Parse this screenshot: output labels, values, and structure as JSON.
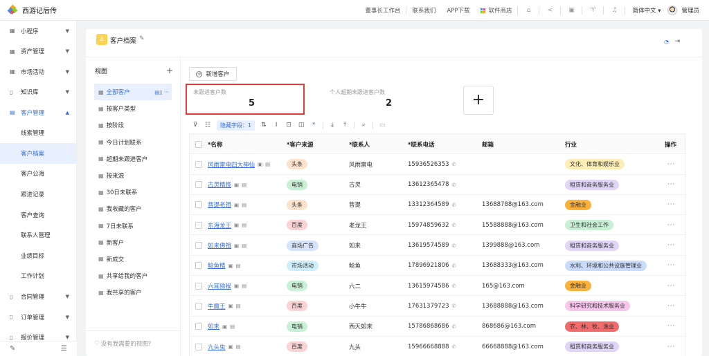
{
  "app": {
    "title": "西游记后传",
    "logo_colors": [
      "#f5a623",
      "#4a90e2",
      "#7ed321",
      "#e94e77"
    ]
  },
  "topbar": {
    "links": [
      "董事长工作台",
      "联系我们",
      "APP下载",
      "软件商店"
    ],
    "app_store_icon": "grid-colorful-icon",
    "icons": [
      "home-icon",
      "share-icon",
      "app-icon",
      "shirt-icon",
      "bell-icon"
    ],
    "language": "简体中文",
    "user": "管理员"
  },
  "sidebar": {
    "groups_top": [
      {
        "label": "小程序",
        "icon": "grid-icon"
      },
      {
        "label": "资产管理",
        "icon": "grid-icon"
      },
      {
        "label": "市场活动",
        "icon": "grid-icon"
      },
      {
        "label": "知识库",
        "icon": "doc-icon"
      }
    ],
    "open_group": {
      "label": "客户管理",
      "icon": "contact-icon"
    },
    "sub_items": [
      "线索管理",
      "客户档案",
      "客户公海",
      "跟进记录",
      "客户查询",
      "联系人管理",
      "业绩目标",
      "工作计划"
    ],
    "active_sub": "客户档案",
    "groups_bottom": [
      {
        "label": "合同管理",
        "icon": "doc-icon"
      },
      {
        "label": "订单管理",
        "icon": "doc-icon"
      },
      {
        "label": "报价管理",
        "icon": "doc-icon"
      }
    ]
  },
  "header": {
    "title": "客户档案"
  },
  "views": {
    "title": "视图",
    "items": [
      "全部客户",
      "按客户类型",
      "按阶段",
      "今日计划联系",
      "超期未跟进客户",
      "按来源",
      "30日未联系",
      "我收藏的客户",
      "7日未联系",
      "新客户",
      "新成交",
      "共享给我的客户",
      "我共享的客户"
    ],
    "active": "全部客户",
    "footer": "没有我需要的视图?"
  },
  "actions": {
    "add_customer": "新增客户"
  },
  "stats": [
    {
      "label": "未跟进客户数",
      "value": "5"
    },
    {
      "label": "个人超期未跟进客户数",
      "value": "2"
    }
  ],
  "toolbar": {
    "hidden_fields": "隐藏字段：1"
  },
  "table": {
    "columns": [
      "*名称",
      "*客户来源",
      "*联系人",
      "*联系电话",
      "邮箱",
      "行业",
      "操作"
    ],
    "rows": [
      {
        "name": "风雨雷电四大神仙",
        "source": "头条",
        "contact": "风雨雷电",
        "phone": "15936526353",
        "email": "",
        "industry": "文化、体育和娱乐业"
      },
      {
        "name": "古灵精怪",
        "source": "电销",
        "contact": "古灵",
        "phone": "13612365478",
        "email": "",
        "industry": "租赁和商务服务业"
      },
      {
        "name": "菩提老祖",
        "source": "头条",
        "contact": "菩提",
        "phone": "13312364589",
        "email": "13688788@163.com",
        "industry": "金融业"
      },
      {
        "name": "东海龙王",
        "source": "百度",
        "contact": "老龙王",
        "phone": "15974859632",
        "email": "15588888@163.com",
        "industry": "卫生和社会工作"
      },
      {
        "name": "如来佛祖",
        "source": "商场广告",
        "contact": "如来",
        "phone": "13619574589",
        "email": "1399888@163.com",
        "industry": "租赁和商务服务业"
      },
      {
        "name": "鲶鱼精",
        "source": "市场活动",
        "contact": "鲶鱼",
        "phone": "17896921806",
        "email": "13688333@163.com",
        "industry": "水利、环境和公共设施管理业"
      },
      {
        "name": "六耳猕猴",
        "source": "电销",
        "contact": "六二",
        "phone": "13615974586",
        "email": "165@163.com",
        "industry": "金融业"
      },
      {
        "name": "牛魔王",
        "source": "百度",
        "contact": "小牛牛",
        "phone": "17631379723",
        "email": "13688888@163.com",
        "industry": "科学研究和技术服务业"
      },
      {
        "name": "如来",
        "source": "电销",
        "contact": "西天如来",
        "phone": "15786868686",
        "email": "868686@163.com",
        "industry": "农、林、牧、渔业"
      },
      {
        "name": "九头虫",
        "source": "百度",
        "contact": "九头",
        "phone": "15966668888",
        "email": "66668888@163.com",
        "industry": "租赁和商务服务业"
      }
    ],
    "more_label": "···"
  },
  "tag_colors": {
    "头条": "#fde2cc",
    "电销": "#c8f0d4",
    "百度": "#fbd3d3",
    "商场广告": "#d6e4fb",
    "市场活动": "#cdeefb",
    "文化、体育和娱乐业": "#fdeeb5",
    "租赁和商务服务业": "#e0d4f7",
    "金融业": "#fbb13c",
    "卫生和社会工作": "#c8f0d4",
    "水利、环境和公共设施管理业": "#c9dbfb",
    "科学研究和技术服务业": "#f7c6ec",
    "农、林、牧、渔业": "#f26b6b"
  }
}
